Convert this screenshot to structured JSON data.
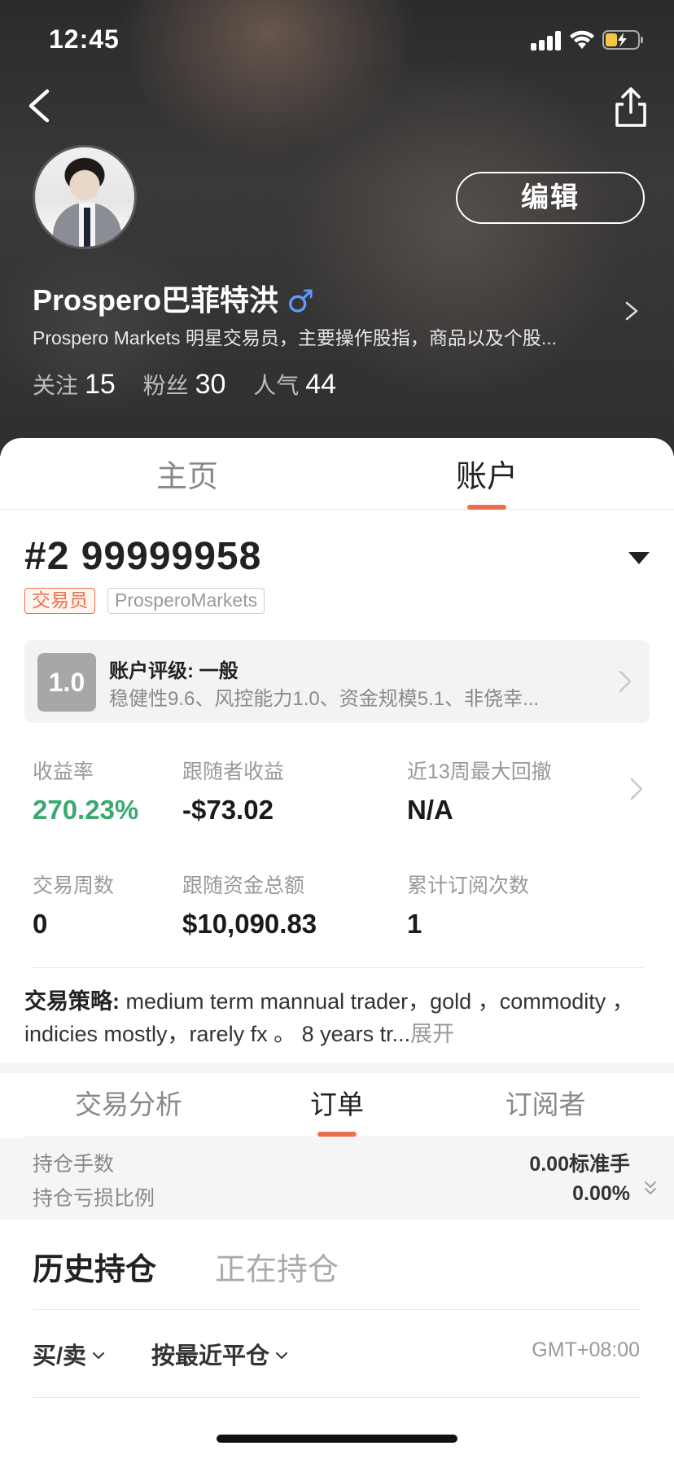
{
  "status_bar": {
    "time": "12:45"
  },
  "profile": {
    "edit_label": "编辑",
    "name": "Prospero巴菲特洪",
    "gender_symbol": "♂",
    "bio": "Prospero Markets 明星交易员，主要操作股指，商品以及个股...",
    "stats": [
      {
        "label": "关注",
        "value": "15"
      },
      {
        "label": "粉丝",
        "value": "30"
      },
      {
        "label": "人气",
        "value": "44"
      }
    ]
  },
  "main_tabs": {
    "home": "主页",
    "account": "账户",
    "active": "account"
  },
  "account": {
    "id": "#2 99999958",
    "badges": {
      "role": "交易员",
      "broker": "ProsperoMarkets"
    },
    "rating": {
      "score": "1.0",
      "title": "账户评级: 一般",
      "detail": "稳健性9.6、风控能力1.0、资金规模5.1、非侥幸..."
    },
    "metrics": [
      {
        "label": "收益率",
        "value": "270.23%"
      },
      {
        "label": "跟随者收益",
        "value": "-$73.02"
      },
      {
        "label": "近13周最大回撤",
        "value": "N/A"
      },
      {
        "label": "交易周数",
        "value": "0"
      },
      {
        "label": "跟随资金总额",
        "value": "$10,090.83"
      },
      {
        "label": "累计订阅次数",
        "value": "1"
      }
    ],
    "strategy": {
      "label": "交易策略:",
      "text": "medium term mannual trader，gold ，commodity ，indicies mostly，rarely fx 。 8 years tr...",
      "expand": "展开"
    }
  },
  "sub_tabs": {
    "analysis": "交易分析",
    "orders": "订单",
    "subscribers": "订阅者",
    "active": "orders"
  },
  "summary": {
    "lots_label": "持仓手数",
    "lots_value": "0.00标准手",
    "pnl_label": "持仓亏损比例",
    "pnl_value": "0.00%"
  },
  "positions": {
    "history": "历史持仓",
    "open": "正在持仓",
    "filter_side": "买/卖",
    "filter_sort": "按最近平仓",
    "timezone": "GMT+08:00"
  },
  "colors": {
    "accent": "#ee6f4c",
    "positive": "#3aa870",
    "gender": "#5b9bff"
  }
}
